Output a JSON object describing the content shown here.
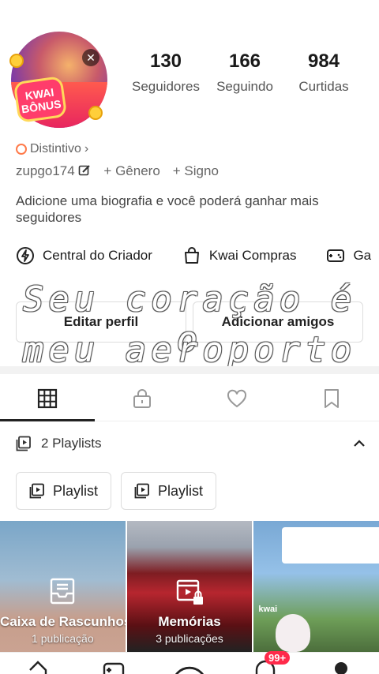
{
  "stats": [
    {
      "value": "130",
      "label": "Seguidores"
    },
    {
      "value": "166",
      "label": "Seguindo"
    },
    {
      "value": "984",
      "label": "Curtidas"
    }
  ],
  "avatar_badge": {
    "line1": "KWAI",
    "line2": "BÔNUS"
  },
  "distintivo": "Distintivo",
  "username": "zupgo174",
  "add_genero": "+ Gênero",
  "add_signo": "+ Signo",
  "bio": "Adicione uma biografia e você poderá ganhar mais seguidores",
  "quick_links": [
    {
      "label": "Central do Criador",
      "icon": "creator-center-icon"
    },
    {
      "label": "Kwai Compras",
      "icon": "shopping-bag-icon"
    },
    {
      "label": "Ga",
      "icon": "gamepad-icon"
    }
  ],
  "buttons": {
    "edit": "Editar perfil",
    "add_friends": "Adicionar amigos"
  },
  "overlay": {
    "line1": "Seu coração é o",
    "line2": "meu aeroporto"
  },
  "playlists": {
    "header": "2 Playlists",
    "items": [
      "Playlist",
      "Playlist"
    ]
  },
  "grid": [
    {
      "title": "Caixa de Rascunhos",
      "subtitle": "1 publicação"
    },
    {
      "title": "Memórias",
      "subtitle": "3 publicações"
    },
    {
      "watermark": "kwai"
    }
  ],
  "nav_badge": "99+"
}
